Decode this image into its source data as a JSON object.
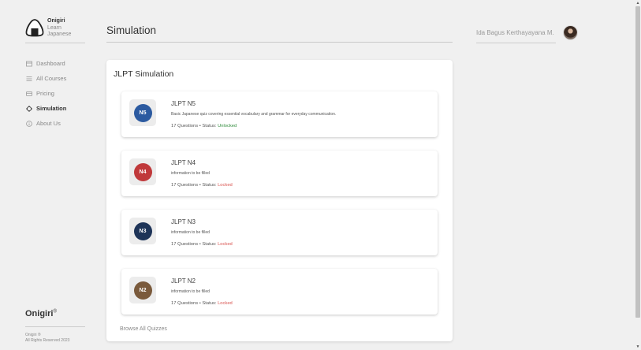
{
  "brand": {
    "name": "Onigiri",
    "line2": "Learn",
    "line3": "Japanese"
  },
  "nav": {
    "items": [
      {
        "label": "Dashboard",
        "icon": "dashboard-icon"
      },
      {
        "label": "All Courses",
        "icon": "list-icon"
      },
      {
        "label": "Pricing",
        "icon": "card-icon"
      },
      {
        "label": "Simulation",
        "icon": "simulation-icon",
        "active": true
      },
      {
        "label": "About Us",
        "icon": "info-icon"
      }
    ]
  },
  "footer": {
    "brand": "Onigiri",
    "mark": "®",
    "copy1": "Onigiri ®",
    "copy2": "All Rights Reserved 2023"
  },
  "header": {
    "title": "Simulation",
    "user_name": "Ida Bagus Kerthayayana M."
  },
  "panel": {
    "title": "JLPT Simulation",
    "cards": [
      {
        "badge": "N5",
        "badge_color": "#2c5aa0",
        "title": "JLPT N5",
        "desc": "Basic Japanese quiz covering essential vocabulary and grammar for everyday communication.",
        "meta_prefix": "17 Questions • Status: ",
        "status": "Unlocked"
      },
      {
        "badge": "N4",
        "badge_color": "#c0393b",
        "title": "JLPT N4",
        "desc": "information to be filled",
        "meta_prefix": "17 Questions • Status: ",
        "status": "Locked"
      },
      {
        "badge": "N3",
        "badge_color": "#1e3458",
        "title": "JLPT N3",
        "desc": "information to be filled",
        "meta_prefix": "17 Questions • Status: ",
        "status": "Locked"
      },
      {
        "badge": "N2",
        "badge_color": "#7a5a3c",
        "title": "JLPT N2",
        "desc": "information to be filled",
        "meta_prefix": "17 Questions • Status: ",
        "status": "Locked"
      }
    ],
    "browse_label": "Browse All Quizzes"
  },
  "scrollbar": {
    "up": "▲",
    "down": "▼"
  }
}
